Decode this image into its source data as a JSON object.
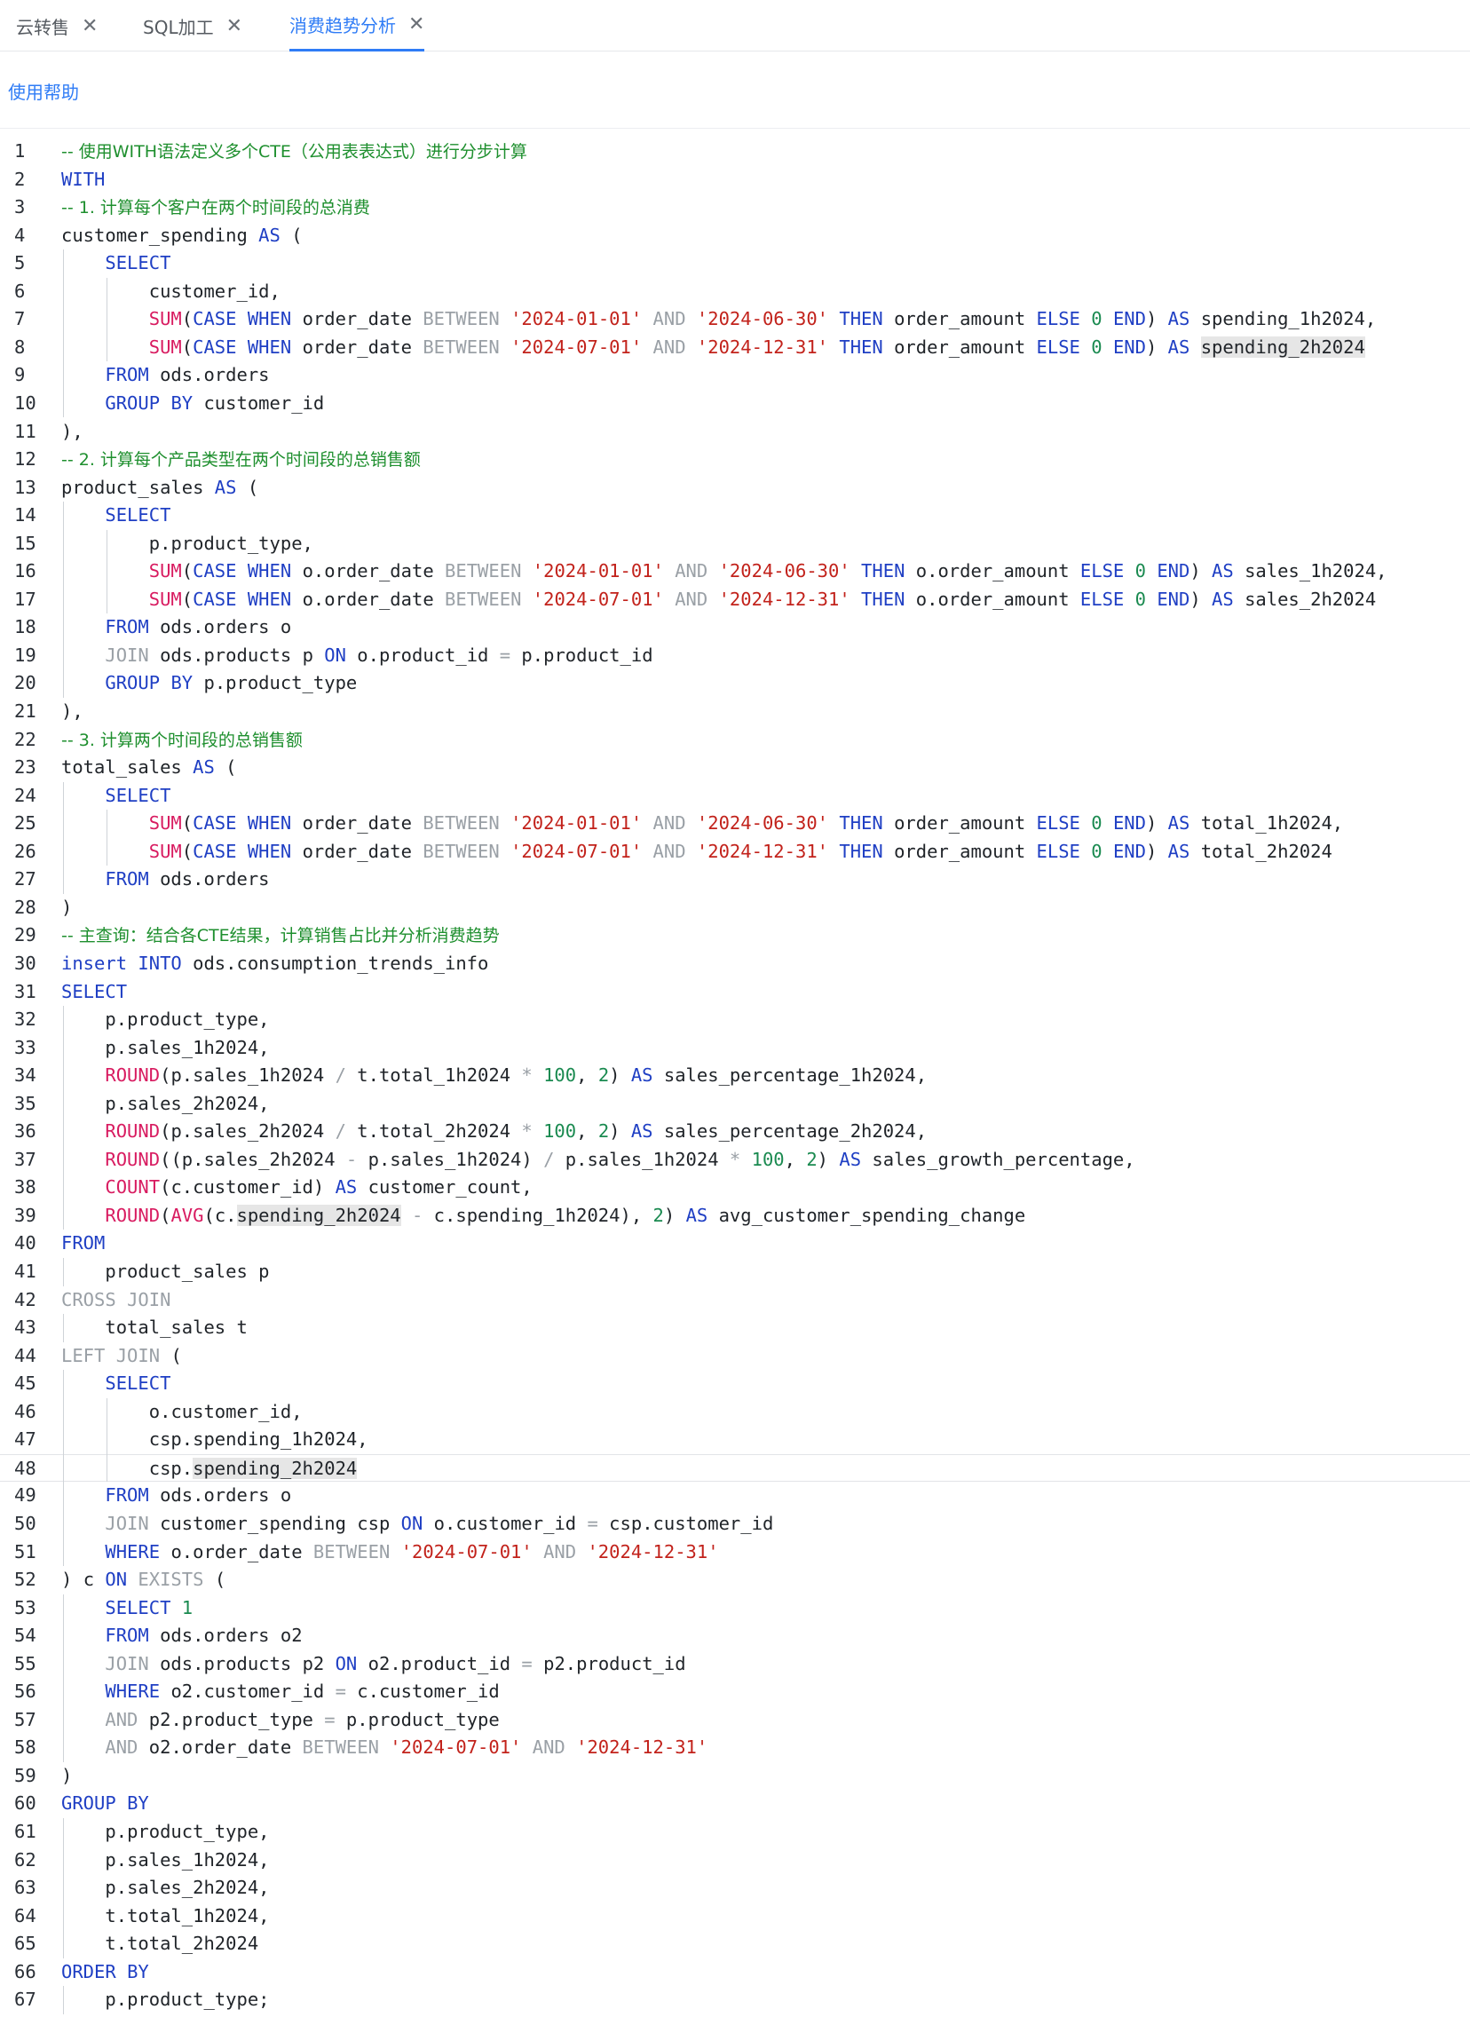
{
  "tabs": [
    {
      "label": "云转售",
      "active": false
    },
    {
      "label": "SQL加工",
      "active": false
    },
    {
      "label": "消费趋势分析",
      "active": true
    }
  ],
  "help_link": "使用帮助",
  "current_line": 48,
  "highlight_token": "spending_2h2024",
  "lines": [
    {
      "n": "1",
      "text": "-- 使用WITH语法定义多个CTE（公用表表达式）进行分步计算"
    },
    {
      "n": "2",
      "text": "WITH"
    },
    {
      "n": "3",
      "text": "-- 1. 计算每个客户在两个时间段的总消费"
    },
    {
      "n": "4",
      "text": "customer_spending AS ("
    },
    {
      "n": "5",
      "text": "    SELECT"
    },
    {
      "n": "6",
      "text": "        customer_id,"
    },
    {
      "n": "7",
      "text": "        SUM(CASE WHEN order_date BETWEEN '2024-01-01' AND '2024-06-30' THEN order_amount ELSE 0 END) AS spending_1h2024,"
    },
    {
      "n": "8",
      "text": "        SUM(CASE WHEN order_date BETWEEN '2024-07-01' AND '2024-12-31' THEN order_amount ELSE 0 END) AS spending_2h2024"
    },
    {
      "n": "9",
      "text": "    FROM ods.orders"
    },
    {
      "n": "10",
      "text": "    GROUP BY customer_id"
    },
    {
      "n": "11",
      "text": "),"
    },
    {
      "n": "12",
      "text": "-- 2. 计算每个产品类型在两个时间段的总销售额"
    },
    {
      "n": "13",
      "text": "product_sales AS ("
    },
    {
      "n": "14",
      "text": "    SELECT"
    },
    {
      "n": "15",
      "text": "        p.product_type,"
    },
    {
      "n": "16",
      "text": "        SUM(CASE WHEN o.order_date BETWEEN '2024-01-01' AND '2024-06-30' THEN o.order_amount ELSE 0 END) AS sales_1h2024,"
    },
    {
      "n": "17",
      "text": "        SUM(CASE WHEN o.order_date BETWEEN '2024-07-01' AND '2024-12-31' THEN o.order_amount ELSE 0 END) AS sales_2h2024"
    },
    {
      "n": "18",
      "text": "    FROM ods.orders o"
    },
    {
      "n": "19",
      "text": "    JOIN ods.products p ON o.product_id = p.product_id"
    },
    {
      "n": "20",
      "text": "    GROUP BY p.product_type"
    },
    {
      "n": "21",
      "text": "),"
    },
    {
      "n": "22",
      "text": "-- 3. 计算两个时间段的总销售额"
    },
    {
      "n": "23",
      "text": "total_sales AS ("
    },
    {
      "n": "24",
      "text": "    SELECT"
    },
    {
      "n": "25",
      "text": "        SUM(CASE WHEN order_date BETWEEN '2024-01-01' AND '2024-06-30' THEN order_amount ELSE 0 END) AS total_1h2024,"
    },
    {
      "n": "26",
      "text": "        SUM(CASE WHEN order_date BETWEEN '2024-07-01' AND '2024-12-31' THEN order_amount ELSE 0 END) AS total_2h2024"
    },
    {
      "n": "27",
      "text": "    FROM ods.orders"
    },
    {
      "n": "28",
      "text": ")"
    },
    {
      "n": "29",
      "text": "-- 主查询：结合各CTE结果，计算销售占比并分析消费趋势"
    },
    {
      "n": "30",
      "text": "insert INTO ods.consumption_trends_info"
    },
    {
      "n": "31",
      "text": "SELECT"
    },
    {
      "n": "32",
      "text": "    p.product_type,"
    },
    {
      "n": "33",
      "text": "    p.sales_1h2024,"
    },
    {
      "n": "34",
      "text": "    ROUND(p.sales_1h2024 / t.total_1h2024 * 100, 2) AS sales_percentage_1h2024,"
    },
    {
      "n": "35",
      "text": "    p.sales_2h2024,"
    },
    {
      "n": "36",
      "text": "    ROUND(p.sales_2h2024 / t.total_2h2024 * 100, 2) AS sales_percentage_2h2024,"
    },
    {
      "n": "37",
      "text": "    ROUND((p.sales_2h2024 - p.sales_1h2024) / p.sales_1h2024 * 100, 2) AS sales_growth_percentage,"
    },
    {
      "n": "38",
      "text": "    COUNT(c.customer_id) AS customer_count,"
    },
    {
      "n": "39",
      "text": "    ROUND(AVG(c.spending_2h2024 - c.spending_1h2024), 2) AS avg_customer_spending_change"
    },
    {
      "n": "40",
      "text": "FROM"
    },
    {
      "n": "41",
      "text": "    product_sales p"
    },
    {
      "n": "42",
      "text": "CROSS JOIN"
    },
    {
      "n": "43",
      "text": "    total_sales t"
    },
    {
      "n": "44",
      "text": "LEFT JOIN ("
    },
    {
      "n": "45",
      "text": "    SELECT"
    },
    {
      "n": "46",
      "text": "        o.customer_id,"
    },
    {
      "n": "47",
      "text": "        csp.spending_1h2024,"
    },
    {
      "n": "48",
      "text": "        csp.spending_2h2024"
    },
    {
      "n": "49",
      "text": "    FROM ods.orders o"
    },
    {
      "n": "50",
      "text": "    JOIN customer_spending csp ON o.customer_id = csp.customer_id"
    },
    {
      "n": "51",
      "text": "    WHERE o.order_date BETWEEN '2024-07-01' AND '2024-12-31'"
    },
    {
      "n": "52",
      "text": ") c ON EXISTS ("
    },
    {
      "n": "53",
      "text": "    SELECT 1"
    },
    {
      "n": "54",
      "text": "    FROM ods.orders o2"
    },
    {
      "n": "55",
      "text": "    JOIN ods.products p2 ON o2.product_id = p2.product_id"
    },
    {
      "n": "56",
      "text": "    WHERE o2.customer_id = c.customer_id"
    },
    {
      "n": "57",
      "text": "    AND p2.product_type = p.product_type"
    },
    {
      "n": "58",
      "text": "    AND o2.order_date BETWEEN '2024-07-01' AND '2024-12-31'"
    },
    {
      "n": "59",
      "text": ")"
    },
    {
      "n": "60",
      "text": "GROUP BY"
    },
    {
      "n": "61",
      "text": "    p.product_type,"
    },
    {
      "n": "62",
      "text": "    p.sales_1h2024,"
    },
    {
      "n": "63",
      "text": "    p.sales_2h2024,"
    },
    {
      "n": "64",
      "text": "    t.total_1h2024,"
    },
    {
      "n": "65",
      "text": "    t.total_2h2024"
    },
    {
      "n": "66",
      "text": "ORDER BY"
    },
    {
      "n": "67",
      "text": "    p.product_type;"
    }
  ]
}
